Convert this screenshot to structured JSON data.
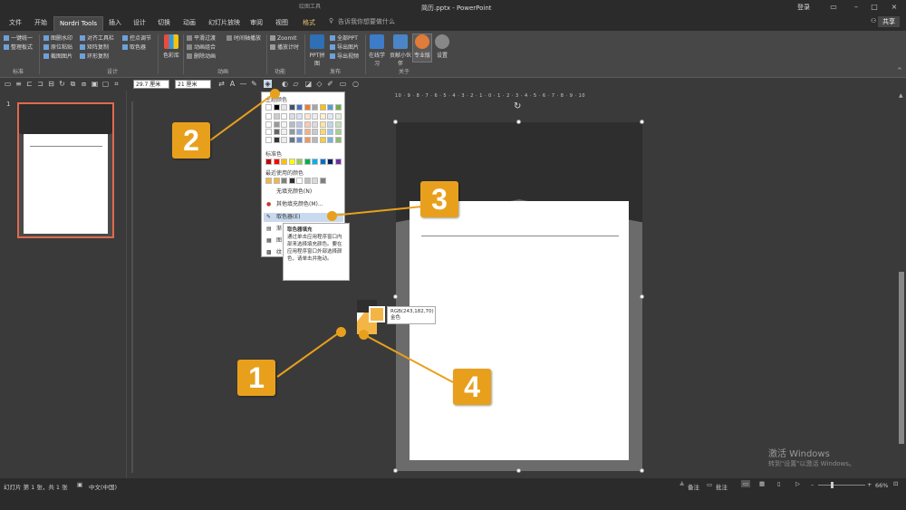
{
  "window": {
    "context_label": "绘图工具",
    "title": "简历.pptx - PowerPoint",
    "login": "登录",
    "controls": [
      "–",
      "□",
      "×"
    ],
    "restore": "▭"
  },
  "tabs": [
    "文件",
    "开始",
    "Nordri Tools",
    "插入",
    "设计",
    "切换",
    "动画",
    "幻灯片放映",
    "审阅",
    "视图",
    "格式"
  ],
  "tell_me": "告诉我你想要做什么",
  "share": "共享",
  "ribbon": {
    "standard": {
      "items": [
        "一键统一",
        "整理板式"
      ],
      "label": "标准"
    },
    "design": {
      "items": [
        "图删水印",
        "原位粘贴",
        "截图图片",
        "对齐工具栏",
        "矩阵复制",
        "环形复制",
        "控点调节",
        "取色器"
      ],
      "label": "设计"
    },
    "color": {
      "big": "色彩库"
    },
    "animation": {
      "items": [
        "平滑过渡",
        "动画组合",
        "删除动画",
        "时间轴播放"
      ],
      "label": "动画"
    },
    "tools": {
      "items": [
        "ZoomIt",
        "播放计时"
      ],
      "label": "功能"
    },
    "publish": {
      "big": "PPT拼图",
      "items": [
        "全部PPT",
        "导出图片",
        "导出视频"
      ],
      "label": "发布"
    },
    "about": {
      "big": [
        "在线学习",
        "贡献小伙伴",
        "专业版",
        "设置"
      ],
      "label": "关于"
    }
  },
  "toolbar": {
    "width": "29.7 厘米",
    "height": "21 厘米"
  },
  "thumbnail": {
    "number": "1"
  },
  "hruler": "10 · 9 · 8 · 7 · 6 · 5 · 4 · 3 · 2 · 1 · 0 · 1 · 2 · 3 · 4 · 5 · 6 · 7 · 8 · 9 · 10",
  "color_menu": {
    "theme_colors": "主题颜色",
    "standard_colors": "标准色",
    "recent_colors": "最近使用的颜色",
    "no_fill": "无填充颜色(N)",
    "more_fill": "其他填充颜色(M)...",
    "eyedropper": "取色器(E)",
    "gradient": "渐",
    "picture": "图",
    "texture": "纹",
    "theme_palette": [
      "#ffffff",
      "#000000",
      "#e7e6e6",
      "#44546a",
      "#4472c4",
      "#ed7d31",
      "#a5a5a5",
      "#ffc000",
      "#5b9bd5",
      "#70ad47"
    ],
    "standard_palette": [
      "#c00000",
      "#ff0000",
      "#ffc000",
      "#ffff00",
      "#92d050",
      "#00b050",
      "#00b0f0",
      "#0070c0",
      "#002060",
      "#7030a0"
    ],
    "recent_palette": [
      "#f3b646",
      "#f3b646",
      "#808080",
      "#2e2e2e",
      "#ffffff",
      "#bfbfbf",
      "#d9d9d9",
      "#7f7f7f"
    ]
  },
  "tooltip": {
    "title": "取色器填充",
    "body": "通过单击应用程序窗口内部来选择填充颜色。要在应用程序窗口外部选择颜色，请单击并拖动。"
  },
  "picker": {
    "rgb": "RGB(243,182,70)",
    "name": "金色",
    "color": "#f3b646"
  },
  "callouts": {
    "c1": "1",
    "c2": "2",
    "c3": "3",
    "c4": "4"
  },
  "watermark": {
    "line1": "激活 Windows",
    "line2": "转到\"设置\"以激活 Windows。"
  },
  "status": {
    "slide_info": "幻灯片 第 1 张，共 1 张",
    "language": "中文(中国)",
    "notes": "备注",
    "comments": "批注",
    "zoom": "66%"
  },
  "colors": {
    "accent": "#e8a01c",
    "selection": "#e06a4d",
    "dark": "#2e2e2e"
  }
}
